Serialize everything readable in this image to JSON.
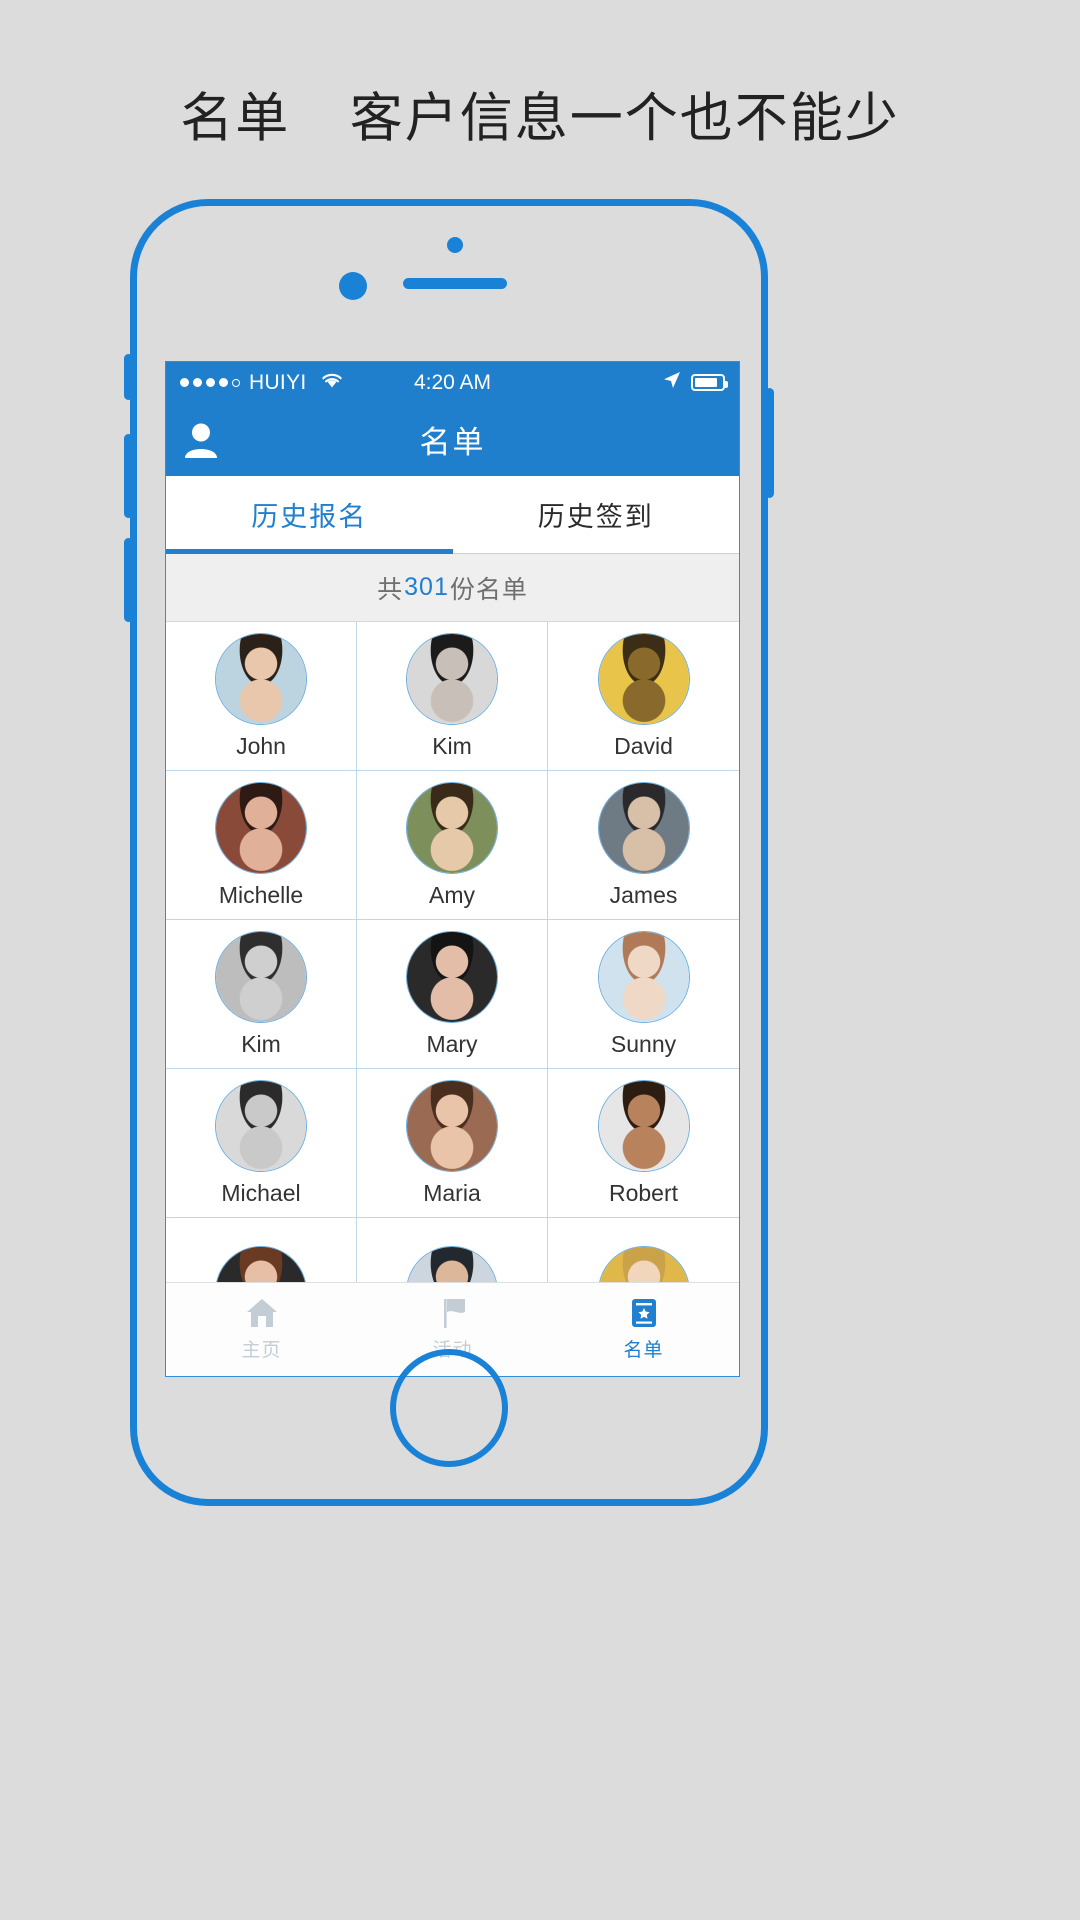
{
  "headline": {
    "title": "名单",
    "subtitle": "客户信息一个也不能少"
  },
  "statusbar": {
    "carrier": "HUIYI",
    "time": "4:20 AM",
    "signal_dots_filled": 4,
    "signal_dots_total": 5,
    "wifi_icon": "wifi-icon",
    "location_icon": "location-arrow-icon",
    "battery_icon": "battery-icon",
    "battery_level": 85
  },
  "navbar": {
    "title": "名单",
    "user_icon": "user-icon"
  },
  "tabs": [
    {
      "label": "历史报名",
      "active": true
    },
    {
      "label": "历史签到",
      "active": false
    }
  ],
  "count_banner": {
    "prefix": "共",
    "count": "301",
    "suffix": "份名单"
  },
  "roster": [
    {
      "name": "John",
      "avatar": "avatar-john"
    },
    {
      "name": "Kim",
      "avatar": "avatar-kim-1"
    },
    {
      "name": "David",
      "avatar": "avatar-david"
    },
    {
      "name": "Michelle",
      "avatar": "avatar-michelle"
    },
    {
      "name": "Amy",
      "avatar": "avatar-amy"
    },
    {
      "name": "James",
      "avatar": "avatar-james"
    },
    {
      "name": "Kim",
      "avatar": "avatar-kim-2"
    },
    {
      "name": "Mary",
      "avatar": "avatar-mary"
    },
    {
      "name": "Sunny",
      "avatar": "avatar-sunny"
    },
    {
      "name": "Michael",
      "avatar": "avatar-michael"
    },
    {
      "name": "Maria",
      "avatar": "avatar-maria"
    },
    {
      "name": "Robert",
      "avatar": "avatar-robert"
    },
    {
      "name": "",
      "avatar": "avatar-row5-1"
    },
    {
      "name": "",
      "avatar": "avatar-row5-2"
    },
    {
      "name": "",
      "avatar": "avatar-row5-3"
    }
  ],
  "tabbar": [
    {
      "label": "主页",
      "icon": "home-icon",
      "active": false
    },
    {
      "label": "活动",
      "icon": "flag-icon",
      "active": false
    },
    {
      "label": "名单",
      "icon": "roster-icon",
      "active": true
    }
  ],
  "colors": {
    "accent": "#1f7fcd",
    "device_outline": "#1a82d6",
    "page_background": "#dcdcdc",
    "tab_inactive": "#c3cdd6",
    "grid_line": "#bcd8ee"
  }
}
